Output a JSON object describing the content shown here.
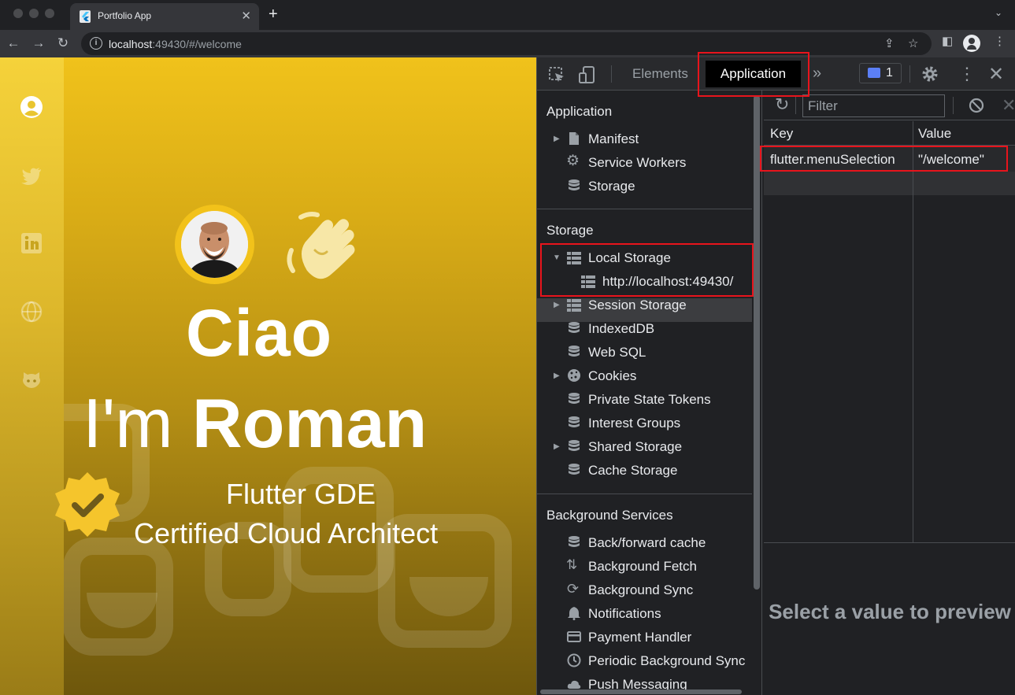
{
  "browser": {
    "tab_title": "Portfolio App",
    "url_host": "localhost",
    "url_rest": ":49430/#/welcome"
  },
  "app": {
    "greeting": "Ciao",
    "intro_prefix": "I'm",
    "name": "Roman",
    "subtitle_1": "Flutter GDE",
    "subtitle_2": "Certified Cloud Architect",
    "rail_icons": [
      "account-icon",
      "twitter-icon",
      "linkedin-icon",
      "globe-icon",
      "github-icon"
    ],
    "accent_color": "#f0c21b"
  },
  "devtools": {
    "tabs": {
      "elements": "Elements",
      "application": "Application"
    },
    "issues_count": "1",
    "sidebar": {
      "application_title": "Application",
      "application_items": [
        {
          "label": "Manifest"
        },
        {
          "label": "Service Workers"
        },
        {
          "label": "Storage"
        }
      ],
      "storage_title": "Storage",
      "storage_items": [
        {
          "label": "Local Storage"
        },
        {
          "label": "http://localhost:49430/"
        },
        {
          "label": "Session Storage"
        },
        {
          "label": "IndexedDB"
        },
        {
          "label": "Web SQL"
        },
        {
          "label": "Cookies"
        },
        {
          "label": "Private State Tokens"
        },
        {
          "label": "Interest Groups"
        },
        {
          "label": "Shared Storage"
        },
        {
          "label": "Cache Storage"
        }
      ],
      "background_title": "Background Services",
      "background_items": [
        {
          "label": "Back/forward cache"
        },
        {
          "label": "Background Fetch"
        },
        {
          "label": "Background Sync"
        },
        {
          "label": "Notifications"
        },
        {
          "label": "Payment Handler"
        },
        {
          "label": "Periodic Background Sync"
        },
        {
          "label": "Push Messaging"
        }
      ]
    },
    "filter_placeholder": "Filter",
    "table": {
      "headers": {
        "key": "Key",
        "value": "Value"
      },
      "rows": [
        {
          "key": "flutter.menuSelection",
          "value": "\"/welcome\""
        }
      ]
    },
    "preview_text": "Select a value to preview"
  }
}
